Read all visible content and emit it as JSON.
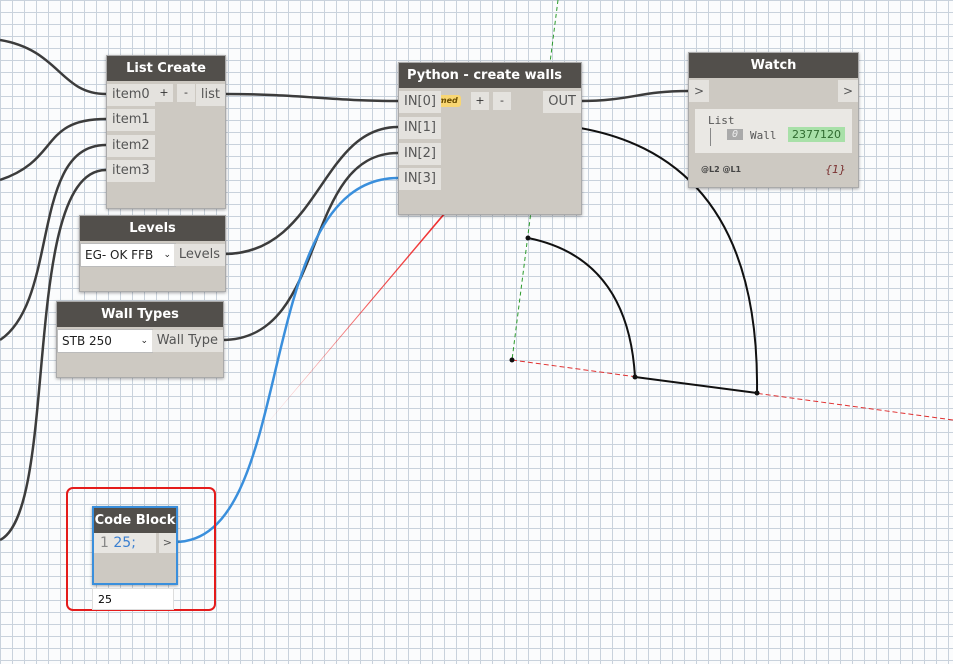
{
  "list_create": {
    "title": "List Create",
    "inputs": [
      "item0",
      "item1",
      "item2",
      "item3"
    ],
    "add": "+",
    "remove": "-",
    "output": "list"
  },
  "levels": {
    "title": "Levels",
    "selected": "EG- OK FFB",
    "output": "Levels"
  },
  "wall_types": {
    "title": "Wall Types",
    "selected": "STB 250",
    "output": "Wall Type"
  },
  "python": {
    "title": "Python - create walls",
    "badge": "Renamed",
    "inputs": [
      "IN[0]",
      "IN[1]",
      "IN[2]",
      "IN[3]"
    ],
    "add": "+",
    "remove": "-",
    "output": "OUT"
  },
  "watch": {
    "title": "Watch",
    "in_port": ">",
    "out_port": ">",
    "list_label": "List",
    "index": "0",
    "item_type": "Wall",
    "item_value": "2377120",
    "levels": "@L2 @L1",
    "count": "{1}"
  },
  "code_block": {
    "title": "Code Block",
    "line_number": "1",
    "code": "25;",
    "output": ">",
    "preview": "25"
  },
  "colors": {
    "wire": "#3c3c3c",
    "selected_wire": "#3a8fdc",
    "annotation_arrow": "#ee1111",
    "highlight_box": "#e41b1b",
    "watch_value_bg": "#a8e0a8"
  }
}
